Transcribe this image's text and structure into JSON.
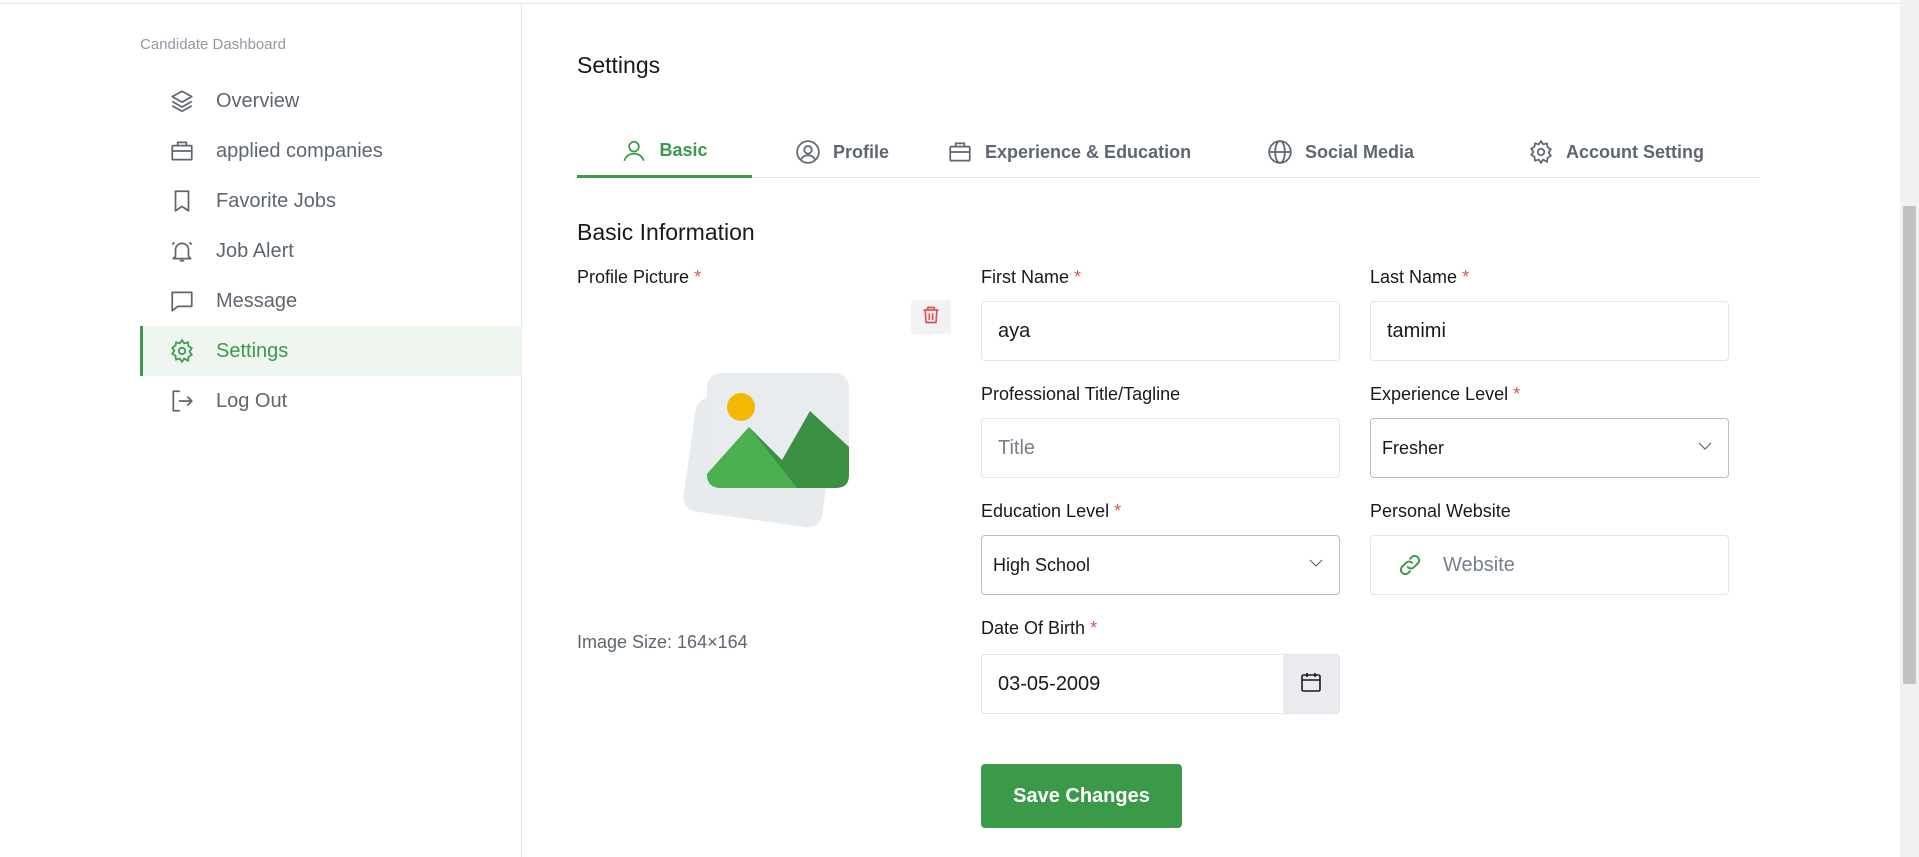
{
  "sidebar": {
    "heading": "Candidate Dashboard",
    "items": [
      {
        "label": "Overview",
        "icon": "layers-icon"
      },
      {
        "label": "applied companies",
        "icon": "briefcase-icon"
      },
      {
        "label": "Favorite Jobs",
        "icon": "bookmark-icon"
      },
      {
        "label": "Job Alert",
        "icon": "bell-icon"
      },
      {
        "label": "Message",
        "icon": "message-icon"
      },
      {
        "label": "Settings",
        "icon": "gear-icon",
        "active": true
      },
      {
        "label": "Log Out",
        "icon": "logout-icon"
      }
    ]
  },
  "main": {
    "title": "Settings",
    "tabs": [
      {
        "label": "Basic",
        "icon": "user-icon",
        "active": true
      },
      {
        "label": "Profile",
        "icon": "user-circle-icon"
      },
      {
        "label": "Experience & Education",
        "icon": "briefcase-icon"
      },
      {
        "label": "Social Media",
        "icon": "globe-icon"
      },
      {
        "label": "Account Setting",
        "icon": "gear-icon"
      }
    ],
    "section_title": "Basic Information"
  },
  "form": {
    "profile_picture_label": "Profile Picture",
    "image_size": "Image Size: 164×164",
    "first_name_label": "First Name",
    "first_name_value": "aya",
    "last_name_label": "Last Name",
    "last_name_value": "tamimi",
    "title_label": "Professional Title/Tagline",
    "title_placeholder": "Title",
    "experience_label": "Experience Level",
    "experience_value": "Fresher",
    "education_label": "Education Level",
    "education_value": "High School",
    "website_label": "Personal Website",
    "website_placeholder": "Website",
    "dob_label": "Date Of Birth",
    "dob_value": "03-05-2009",
    "required_mark": "*",
    "save_label": "Save Changes"
  },
  "colors": {
    "accent": "#3b9a4a",
    "required": "#e05151",
    "text": "#18191c",
    "muted": "#5e6670"
  }
}
